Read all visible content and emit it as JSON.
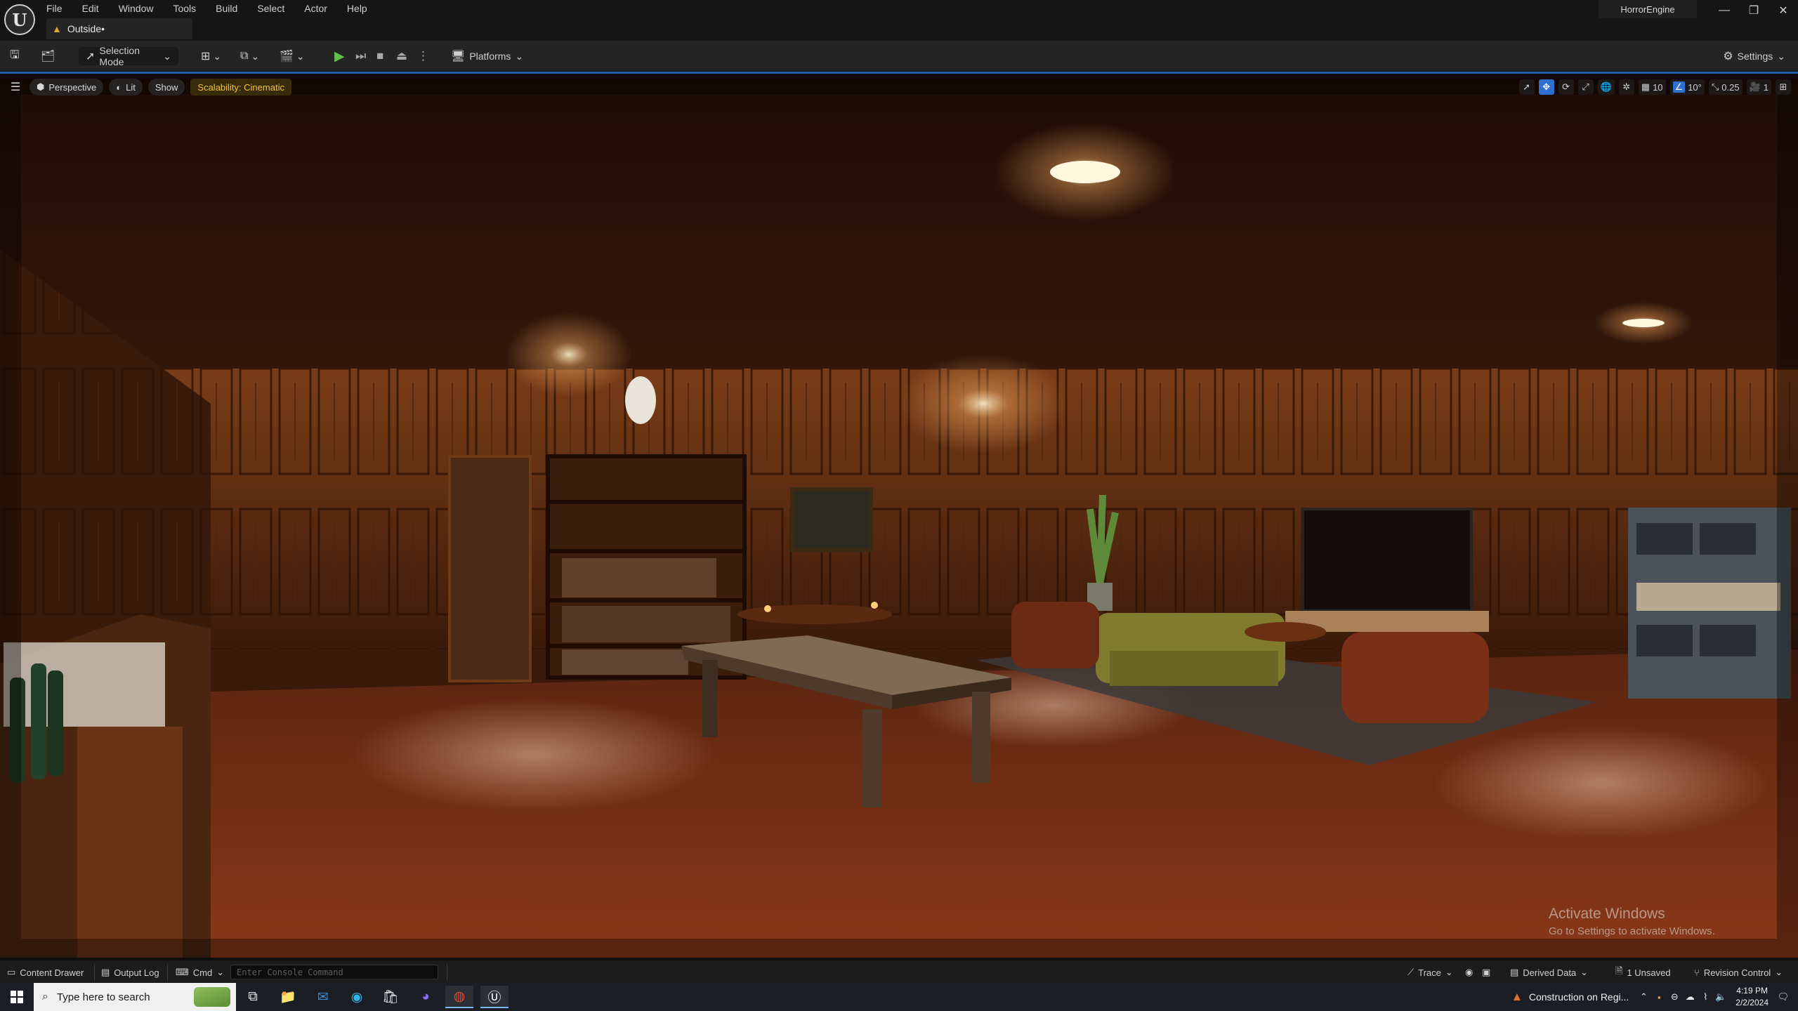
{
  "app": {
    "name": "HorrorEngine",
    "logo_letter": "U",
    "level_tab": "Outside•",
    "window_controls": [
      "—",
      "❐",
      "✕"
    ]
  },
  "menu": [
    "File",
    "Edit",
    "Window",
    "Tools",
    "Build",
    "Select",
    "Actor",
    "Help"
  ],
  "toolbar": {
    "selection_mode": "Selection Mode",
    "platforms": "Platforms",
    "settings": "Settings"
  },
  "viewport": {
    "perspective": "Perspective",
    "lit": "Lit",
    "show": "Show",
    "scalability": "Scalability: Cinematic",
    "grid_snap": "10",
    "rotation_snap": "10°",
    "scale_snap": "0.25",
    "camera_speed": "1"
  },
  "watermark": {
    "title": "Activate Windows",
    "subtitle": "Go to Settings to activate Windows."
  },
  "statusbar": {
    "content_drawer": "Content Drawer",
    "output_log": "Output Log",
    "cmd": "Cmd",
    "console_placeholder": "Enter Console Command",
    "trace": "Trace",
    "derived_data": "Derived Data",
    "unsaved": "1 Unsaved",
    "revision_control": "Revision Control"
  },
  "taskbar": {
    "search_placeholder": "Type here to search",
    "notification": "Construction on Regi...",
    "time": "4:19 PM",
    "date": "2/2/2024"
  },
  "colors": {
    "accent_blue": "#2f6fd1",
    "play_green": "#5fc04a",
    "scalability_yellow": "#f1c232"
  }
}
